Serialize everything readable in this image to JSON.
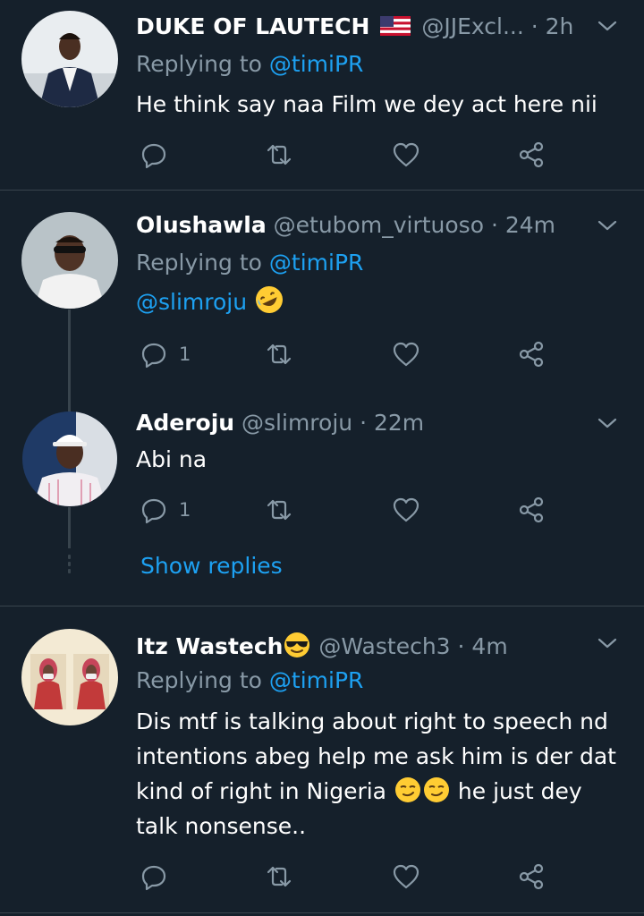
{
  "tweets": [
    {
      "name": "DUKE OF LAUTECH",
      "handle": "@JJExcl...",
      "time": "· 2h",
      "replying_prefix": "Replying to",
      "replying_handle": "@timiPR",
      "text": "He think say naa Film we dey act here nii",
      "reply_count": "",
      "flag_icon": "us-flag-icon"
    },
    {
      "name": "Olushawla",
      "handle": "@etubom_virtuoso",
      "time": "· 24m",
      "replying_prefix": "Replying to",
      "replying_handle": "@timiPR",
      "mention": "@slimroju",
      "emoji_icon": "rolling-laughing-emoji-icon",
      "reply_count": "1"
    },
    {
      "name": "Aderoju",
      "handle": "@slimroju",
      "time": "· 22m",
      "text": "Abi na",
      "reply_count": "1"
    },
    {
      "name": "Itz Wastech",
      "handle": "@Wastech3",
      "time": "· 4m",
      "name_emoji_icon": "sunglasses-emoji-icon",
      "replying_prefix": "Replying to",
      "replying_handle": "@timiPR",
      "text_lines": [
        "Dis mtf is talking about right to speech nd",
        "intentions abeg help me ask him is der dat",
        "kind of right in Nigeria",
        "he just dey",
        "talk nonsense.."
      ],
      "emoji_icon": "smirking-face-emoji-icon"
    }
  ],
  "show_replies": "Show replies",
  "colors": {
    "background": "#15202b",
    "accent": "#1da1f2",
    "secondary_text": "#8899a6",
    "divider": "#38444d"
  }
}
